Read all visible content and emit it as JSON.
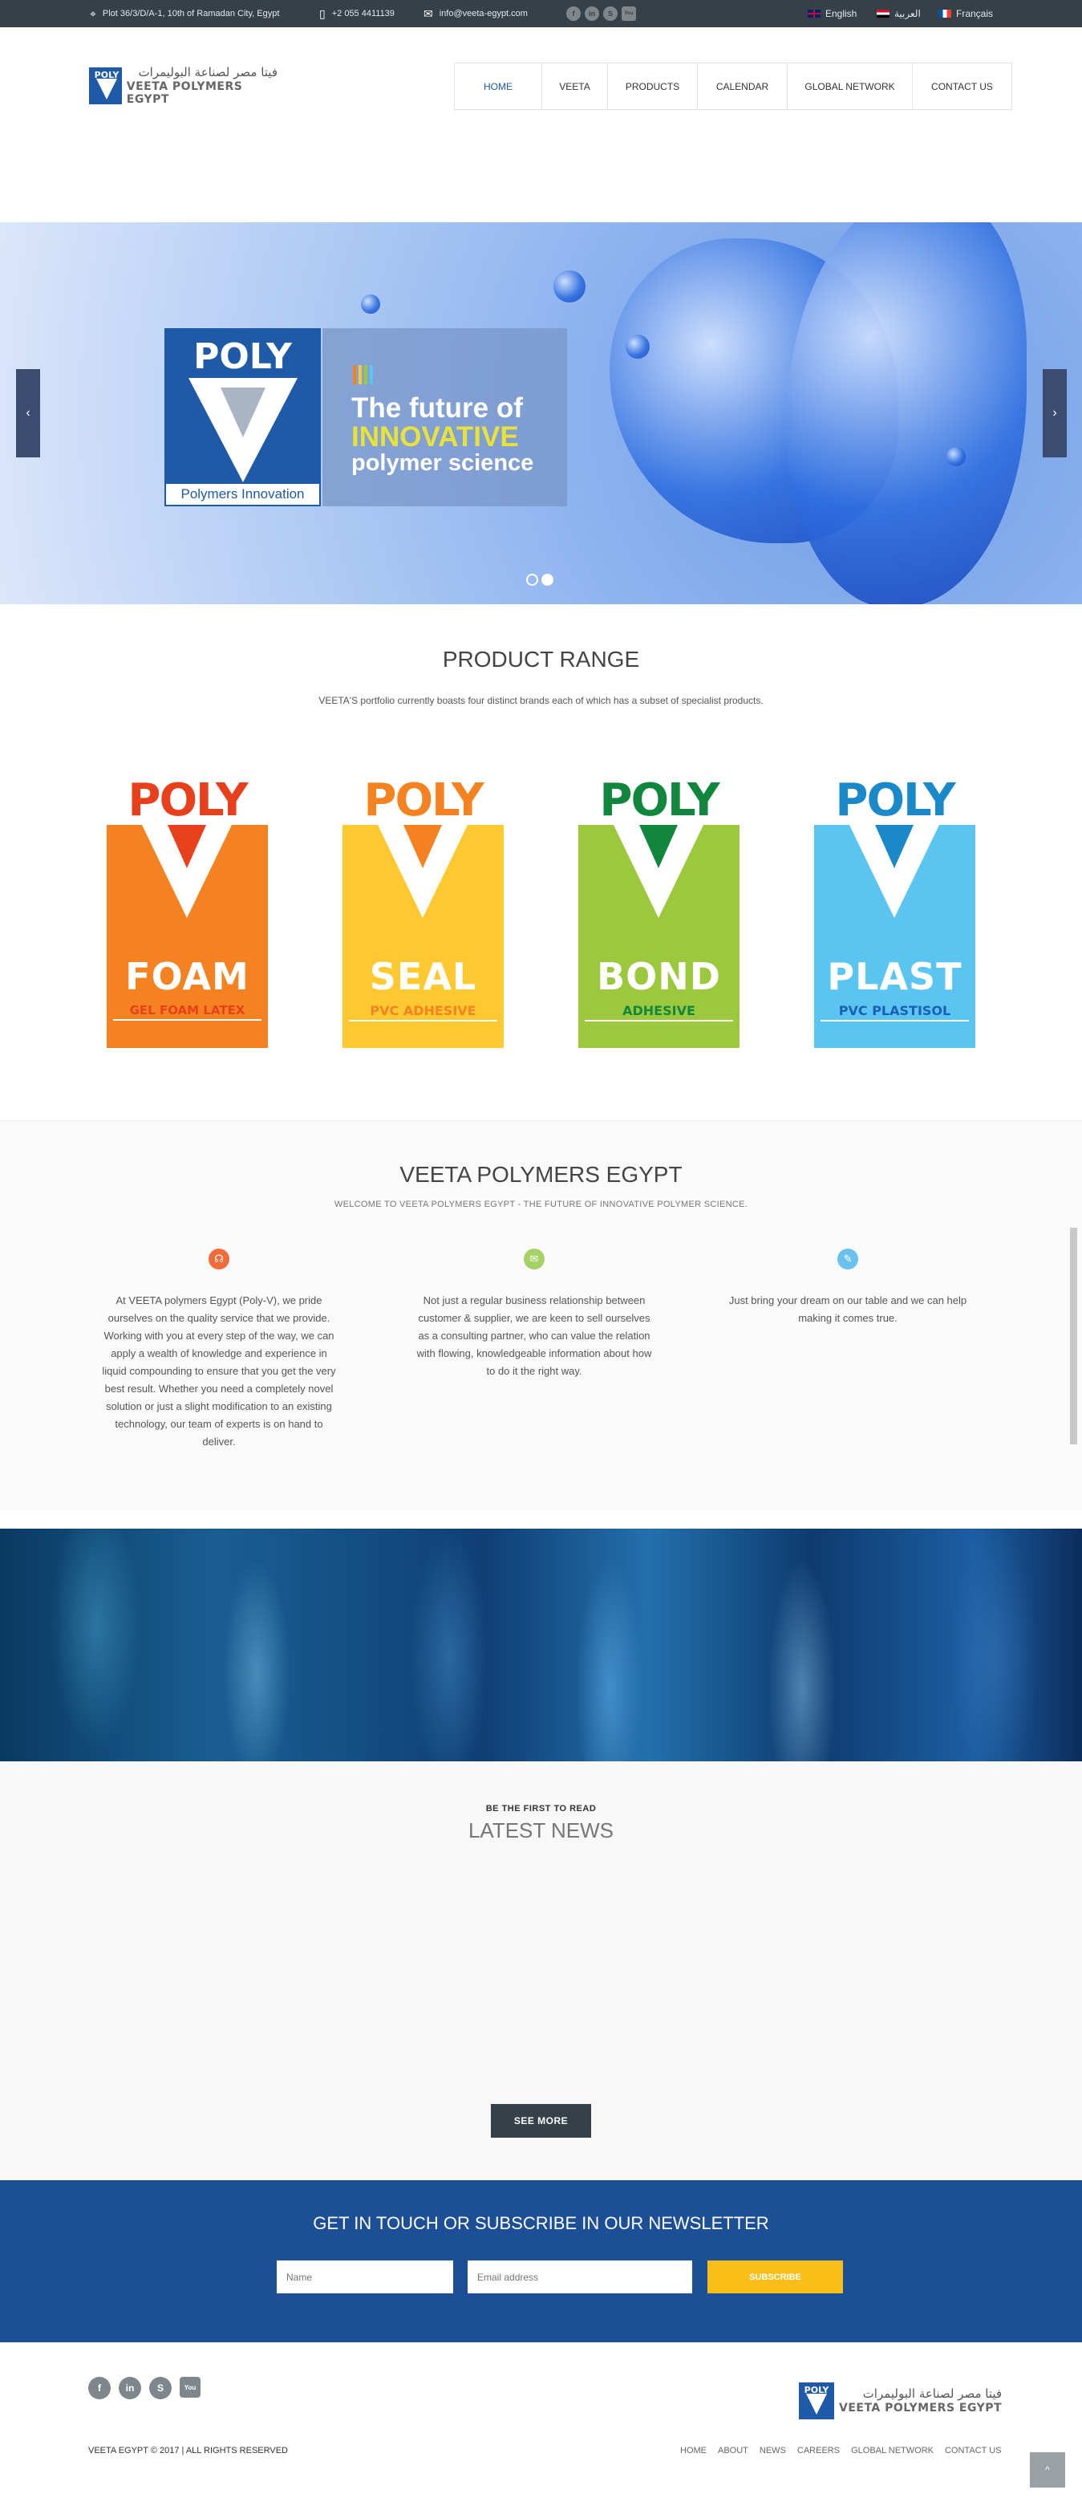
{
  "topbar": {
    "address": "Plot 36/3/D/A-1, 10th of Ramadan City, Egypt",
    "phone": "+2 055 4411139",
    "email": "info@veeta-egypt.com",
    "social": [
      "f",
      "in",
      "S",
      "You"
    ],
    "languages": [
      "English",
      "العربية",
      "Français"
    ]
  },
  "logo": {
    "arabic": "فيتا مصر لصناعة البوليمرات",
    "english": "VEETA POLYMERS EGYPT",
    "mark": "POLY"
  },
  "nav": [
    "HOME",
    "VEETA",
    "PRODUCTS",
    "CALENDAR",
    "GLOBAL NETWORK",
    "CONTACT US"
  ],
  "hero": {
    "logo_word": "POLY",
    "logo_caption": "Polymers Innovation",
    "line1": "The future of",
    "line2": "INNOVATIVE",
    "line3": "polymer science",
    "prev": "‹",
    "next": "›"
  },
  "products": {
    "title": "PRODUCT RANGE",
    "subtitle": "VEETA'S portfolio currently boasts four distinct brands each of which has a subset of specialist products.",
    "items": [
      {
        "top": "POLY",
        "name": "FOAM",
        "sub": "GEL FOAM LATEX",
        "color": "#f58220",
        "accent": "#e8401c"
      },
      {
        "top": "POLY",
        "name": "SEAL",
        "sub": "PVC  ADHESIVE",
        "color": "#fdc830",
        "accent": "#f58220"
      },
      {
        "top": "POLY",
        "name": "BOND",
        "sub": "ADHESIVE",
        "color": "#9bc83c",
        "accent": "#11873d"
      },
      {
        "top": "POLY",
        "name": "PLAST",
        "sub": "PVC  PLASTISOL",
        "color": "#5bc5f2",
        "accent": "#1a88c9"
      }
    ]
  },
  "about": {
    "title": "VEETA POLYMERS EGYPT",
    "subtitle": "WELCOME TO VEETA POLYMERS EGYPT - THE FUTURE OF INNOVATIVE POLYMER SCIENCE.",
    "columns": [
      {
        "icon": "headset-icon",
        "color": "#f26b3a",
        "text": "At VEETA polymers Egypt (Poly-V), we pride ourselves on the quality service that we provide. Working with you at every step of the way, we can apply a wealth of knowledge and experience in liquid compounding to ensure that you get the very best result. Whether you need a completely novel solution or just a slight modification to an existing technology, our team of experts is on hand to deliver."
      },
      {
        "icon": "envelope-icon",
        "color": "#a6d164",
        "text": "Not just a regular business relationship between customer & supplier, we are keen to sell ourselves as a consulting partner, who can value the relation with flowing, knowledgeable information about how to do it the right way."
      },
      {
        "icon": "chat-icon",
        "color": "#6ac1ee",
        "text": "Just bring your dream on our table and we can help making it comes true."
      }
    ]
  },
  "news": {
    "kicker": "BE THE FIRST TO READ",
    "title": "LATEST NEWS",
    "button": "SEE MORE"
  },
  "newsletter": {
    "title": "GET IN TOUCH OR SUBSCRIBE IN OUR NEWSLETTER",
    "name_placeholder": "Name",
    "email_placeholder": "Email address",
    "button": "SUBSCRIBE"
  },
  "footer": {
    "copyright": "VEETA EGYPT © 2017 | ALL RIGHTS RESERVED",
    "links": [
      "HOME",
      "ABOUT",
      "NEWS",
      "CAREERS",
      "GLOBAL NETWORK",
      "CONTACT US"
    ],
    "social": [
      "f",
      "in",
      "S",
      "You"
    ],
    "totop": "^"
  }
}
